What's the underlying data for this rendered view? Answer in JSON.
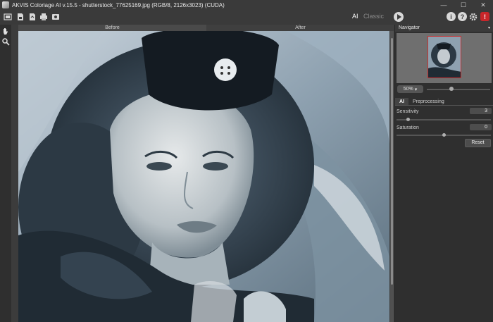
{
  "window": {
    "title": "AKVIS Coloriage AI v.15.5 - shutterstock_77625169.jpg (RGB/8, 2126x3023) (CUDA)",
    "controls": [
      "—",
      "☐",
      "✕"
    ]
  },
  "toolbar": {
    "modes": {
      "ai": "AI",
      "classic": "Classic"
    },
    "buttons": [
      "open-icon",
      "save-icon",
      "export-icon",
      "print-icon",
      "share-icon"
    ]
  },
  "canvas": {
    "before_label": "Before",
    "after_label": "After"
  },
  "navigator": {
    "title": "Navigator",
    "zoom_value": "50%"
  },
  "settings": {
    "tabs": [
      "AI",
      "Preprocessing"
    ],
    "params": [
      {
        "label": "Sensitivity",
        "value": "3",
        "fraction": 0.12
      },
      {
        "label": "Saturation",
        "value": "0",
        "fraction": 0.5
      }
    ],
    "reset_label": "Reset"
  },
  "colors": {
    "accent_red": "#c8262a",
    "photo_tone": "#5e7585"
  }
}
